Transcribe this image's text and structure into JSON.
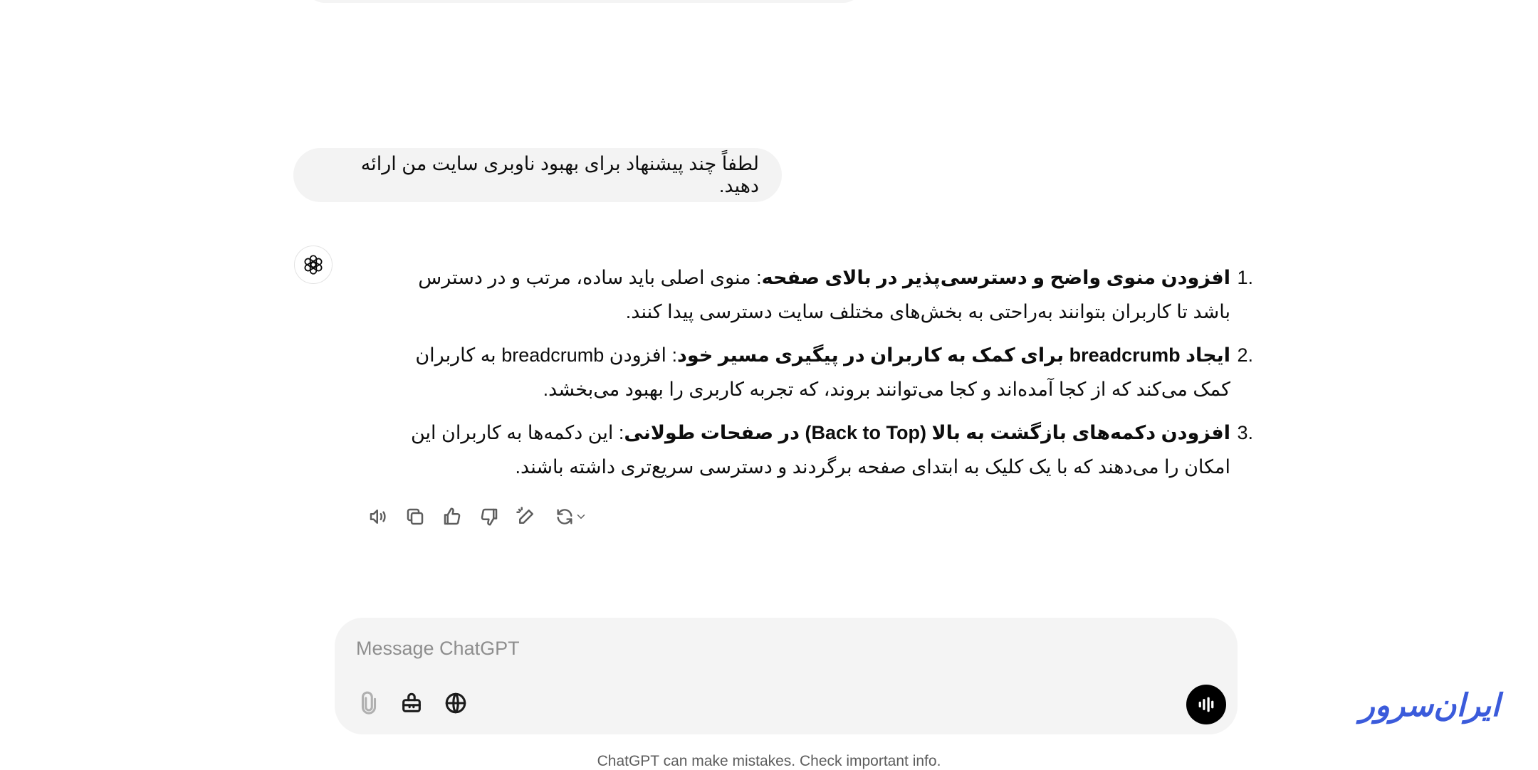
{
  "conversation": {
    "user_message": "لطفاً چند پیشنهاد برای بهبود ناوبری سایت من ارائه دهید.",
    "assistant_items": [
      {
        "number": "1.",
        "title": "افزودن منوی واضح و دسترسی‌پذیر در بالای صفحه",
        "body": ": منوی اصلی باید ساده، مرتب و در دسترس باشد تا کاربران بتوانند به‌راحتی به بخش‌های مختلف سایت دسترسی پیدا کنند."
      },
      {
        "number": "2.",
        "title": "ایجاد breadcrumb برای کمک به کاربران در پیگیری مسیر خود",
        "body": ": افزودن breadcrumb به کاربران کمک می‌کند که از کجا آمده‌اند و کجا می‌توانند بروند، که تجربه کاربری را بهبود می‌بخشد."
      },
      {
        "number": "3.",
        "title": "افزودن دکمه‌های بازگشت به بالا (Back to Top) در صفحات طولانی",
        "body": ": این دکمه‌ها به کاربران این امکان را می‌دهند که با یک کلیک به ابتدای صفحه برگردند و دسترسی سریع‌تری داشته باشند."
      }
    ],
    "actions": [
      "read-aloud-icon",
      "copy-icon",
      "thumbs-up-icon",
      "thumbs-down-icon",
      "edit-canvas-icon",
      "regenerate-icon"
    ]
  },
  "composer": {
    "placeholder": "Message ChatGPT",
    "tools": [
      "paperclip-icon",
      "toolbox-icon",
      "globe-icon"
    ],
    "voice_button": "voice-mode-icon"
  },
  "footer": {
    "disclaimer": "ChatGPT can make mistakes. Check important info."
  },
  "watermark": {
    "text": "ایران‌سرور",
    "color": "#3b5bdb"
  }
}
